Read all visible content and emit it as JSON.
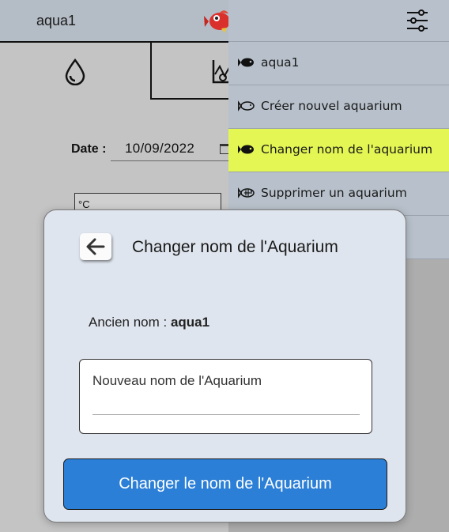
{
  "app": {
    "aquarium_name": "aqua1"
  },
  "form": {
    "date_label": "Date :",
    "date_value": "10/09/2022",
    "temperature_unit": "°C"
  },
  "drawer": {
    "items": [
      {
        "label": "aqua1",
        "icon": "fish-filled-icon",
        "active": false
      },
      {
        "label": "Créer nouvel aquarium",
        "icon": "fish-outline-icon",
        "active": false
      },
      {
        "label": "Changer nom de l'aquarium",
        "icon": "fish-filled-icon",
        "active": true
      },
      {
        "label": "Supprimer un aquarium",
        "icon": "fish-skeleton-icon",
        "active": false
      },
      {
        "label": "",
        "icon": "",
        "active": false
      }
    ]
  },
  "dialog": {
    "title": "Changer nom de l'Aquarium",
    "old_name_label": "Ancien nom : ",
    "old_name_value": "aqua1",
    "new_name_placeholder": "Nouveau nom de l'Aquarium",
    "submit_label": "Changer le nom de l'Aquarium"
  },
  "colors": {
    "active_item": "#e4f653",
    "primary_button": "#2b7fd6",
    "dialog_bg": "#dfe5ee"
  }
}
